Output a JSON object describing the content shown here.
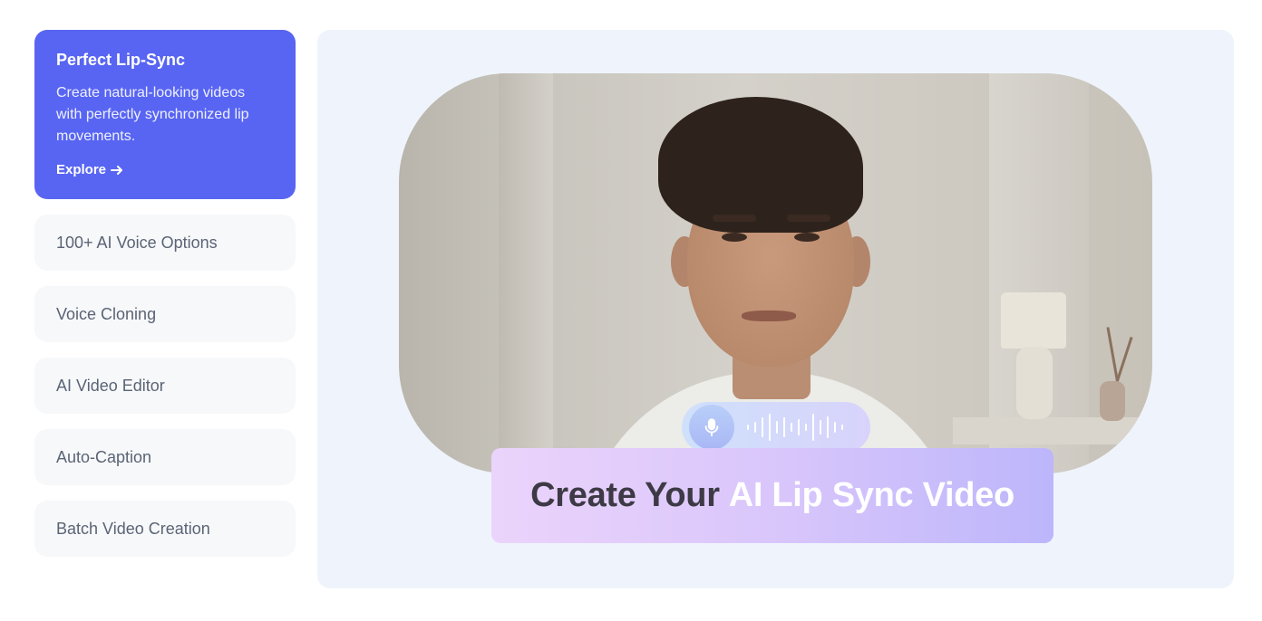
{
  "sidebar": {
    "active": {
      "title": "Perfect Lip-Sync",
      "description": "Create natural-looking videos with perfectly synchronized lip movements.",
      "cta": "Explore"
    },
    "items": [
      {
        "label": "100+ AI Voice Options"
      },
      {
        "label": "Voice Cloning"
      },
      {
        "label": "AI Video Editor"
      },
      {
        "label": "Auto-Caption"
      },
      {
        "label": "Batch Video Creation"
      }
    ]
  },
  "banner": {
    "part1": "Create Your",
    "part2": "AI Lip Sync Video"
  },
  "icons": {
    "cta_arrow": "arrow-right-icon",
    "mic": "microphone-icon"
  },
  "colors": {
    "accent": "#5865f2",
    "card_bg": "#f7f8fa",
    "stage_bg": "#eff4fc"
  }
}
